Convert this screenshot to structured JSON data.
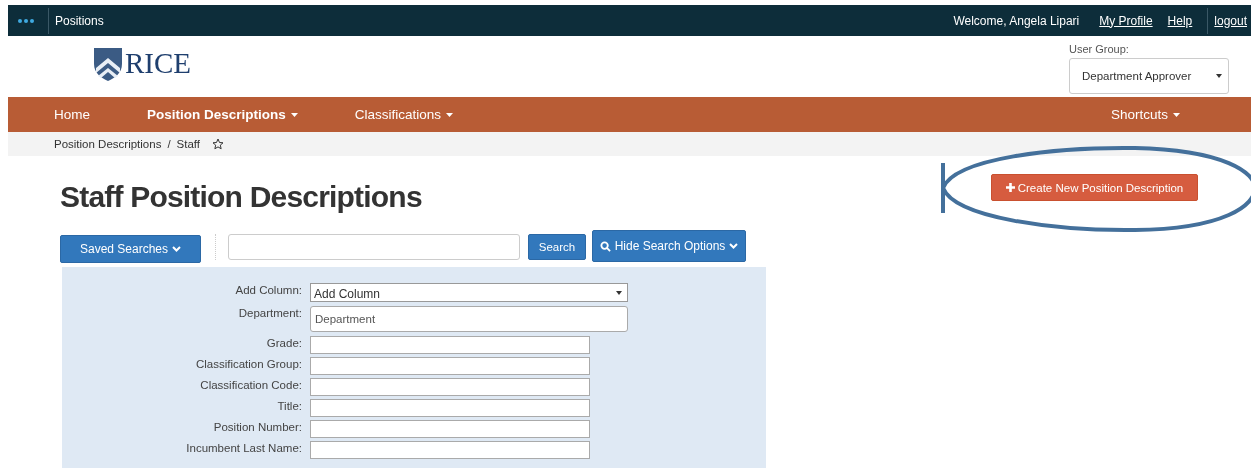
{
  "top_bar": {
    "app_name": "Positions",
    "welcome": "Welcome, Angela Lipari",
    "links": [
      {
        "label": "My Profile"
      },
      {
        "label": "Help"
      },
      {
        "label": "logout"
      }
    ]
  },
  "header": {
    "logo_text": "RICE",
    "user_group": {
      "label": "User Group:",
      "value": "Department Approver"
    }
  },
  "nav": {
    "items": [
      {
        "label": "Home",
        "selected": false,
        "has_menu": false
      },
      {
        "label": "Position Descriptions",
        "selected": true,
        "has_menu": true
      },
      {
        "label": "Classifications",
        "selected": false,
        "has_menu": true
      }
    ],
    "shortcuts": {
      "label": "Shortcuts",
      "has_menu": true
    }
  },
  "breadcrumb": {
    "separator": "/",
    "items": [
      "Position Descriptions",
      "Staff"
    ]
  },
  "page_title": "Staff Position Descriptions",
  "create_button": "Create New Position Description",
  "search_bar": {
    "saved_searches": "Saved Searches",
    "search_button": "Search",
    "toggle_button": "Hide Search Options"
  },
  "search_options": [
    {
      "label": "Add Column:",
      "kind": "select",
      "value": "Add Column"
    },
    {
      "label": "Department:",
      "kind": "text",
      "placeholder": "Department"
    },
    {
      "label": "Grade:",
      "kind": "short"
    },
    {
      "label": "Classification Group:",
      "kind": "short"
    },
    {
      "label": "Classification Code:",
      "kind": "short"
    },
    {
      "label": "Title:",
      "kind": "short"
    },
    {
      "label": "Position Number:",
      "kind": "short"
    },
    {
      "label": "Incumbent Last Name:",
      "kind": "short"
    }
  ]
}
